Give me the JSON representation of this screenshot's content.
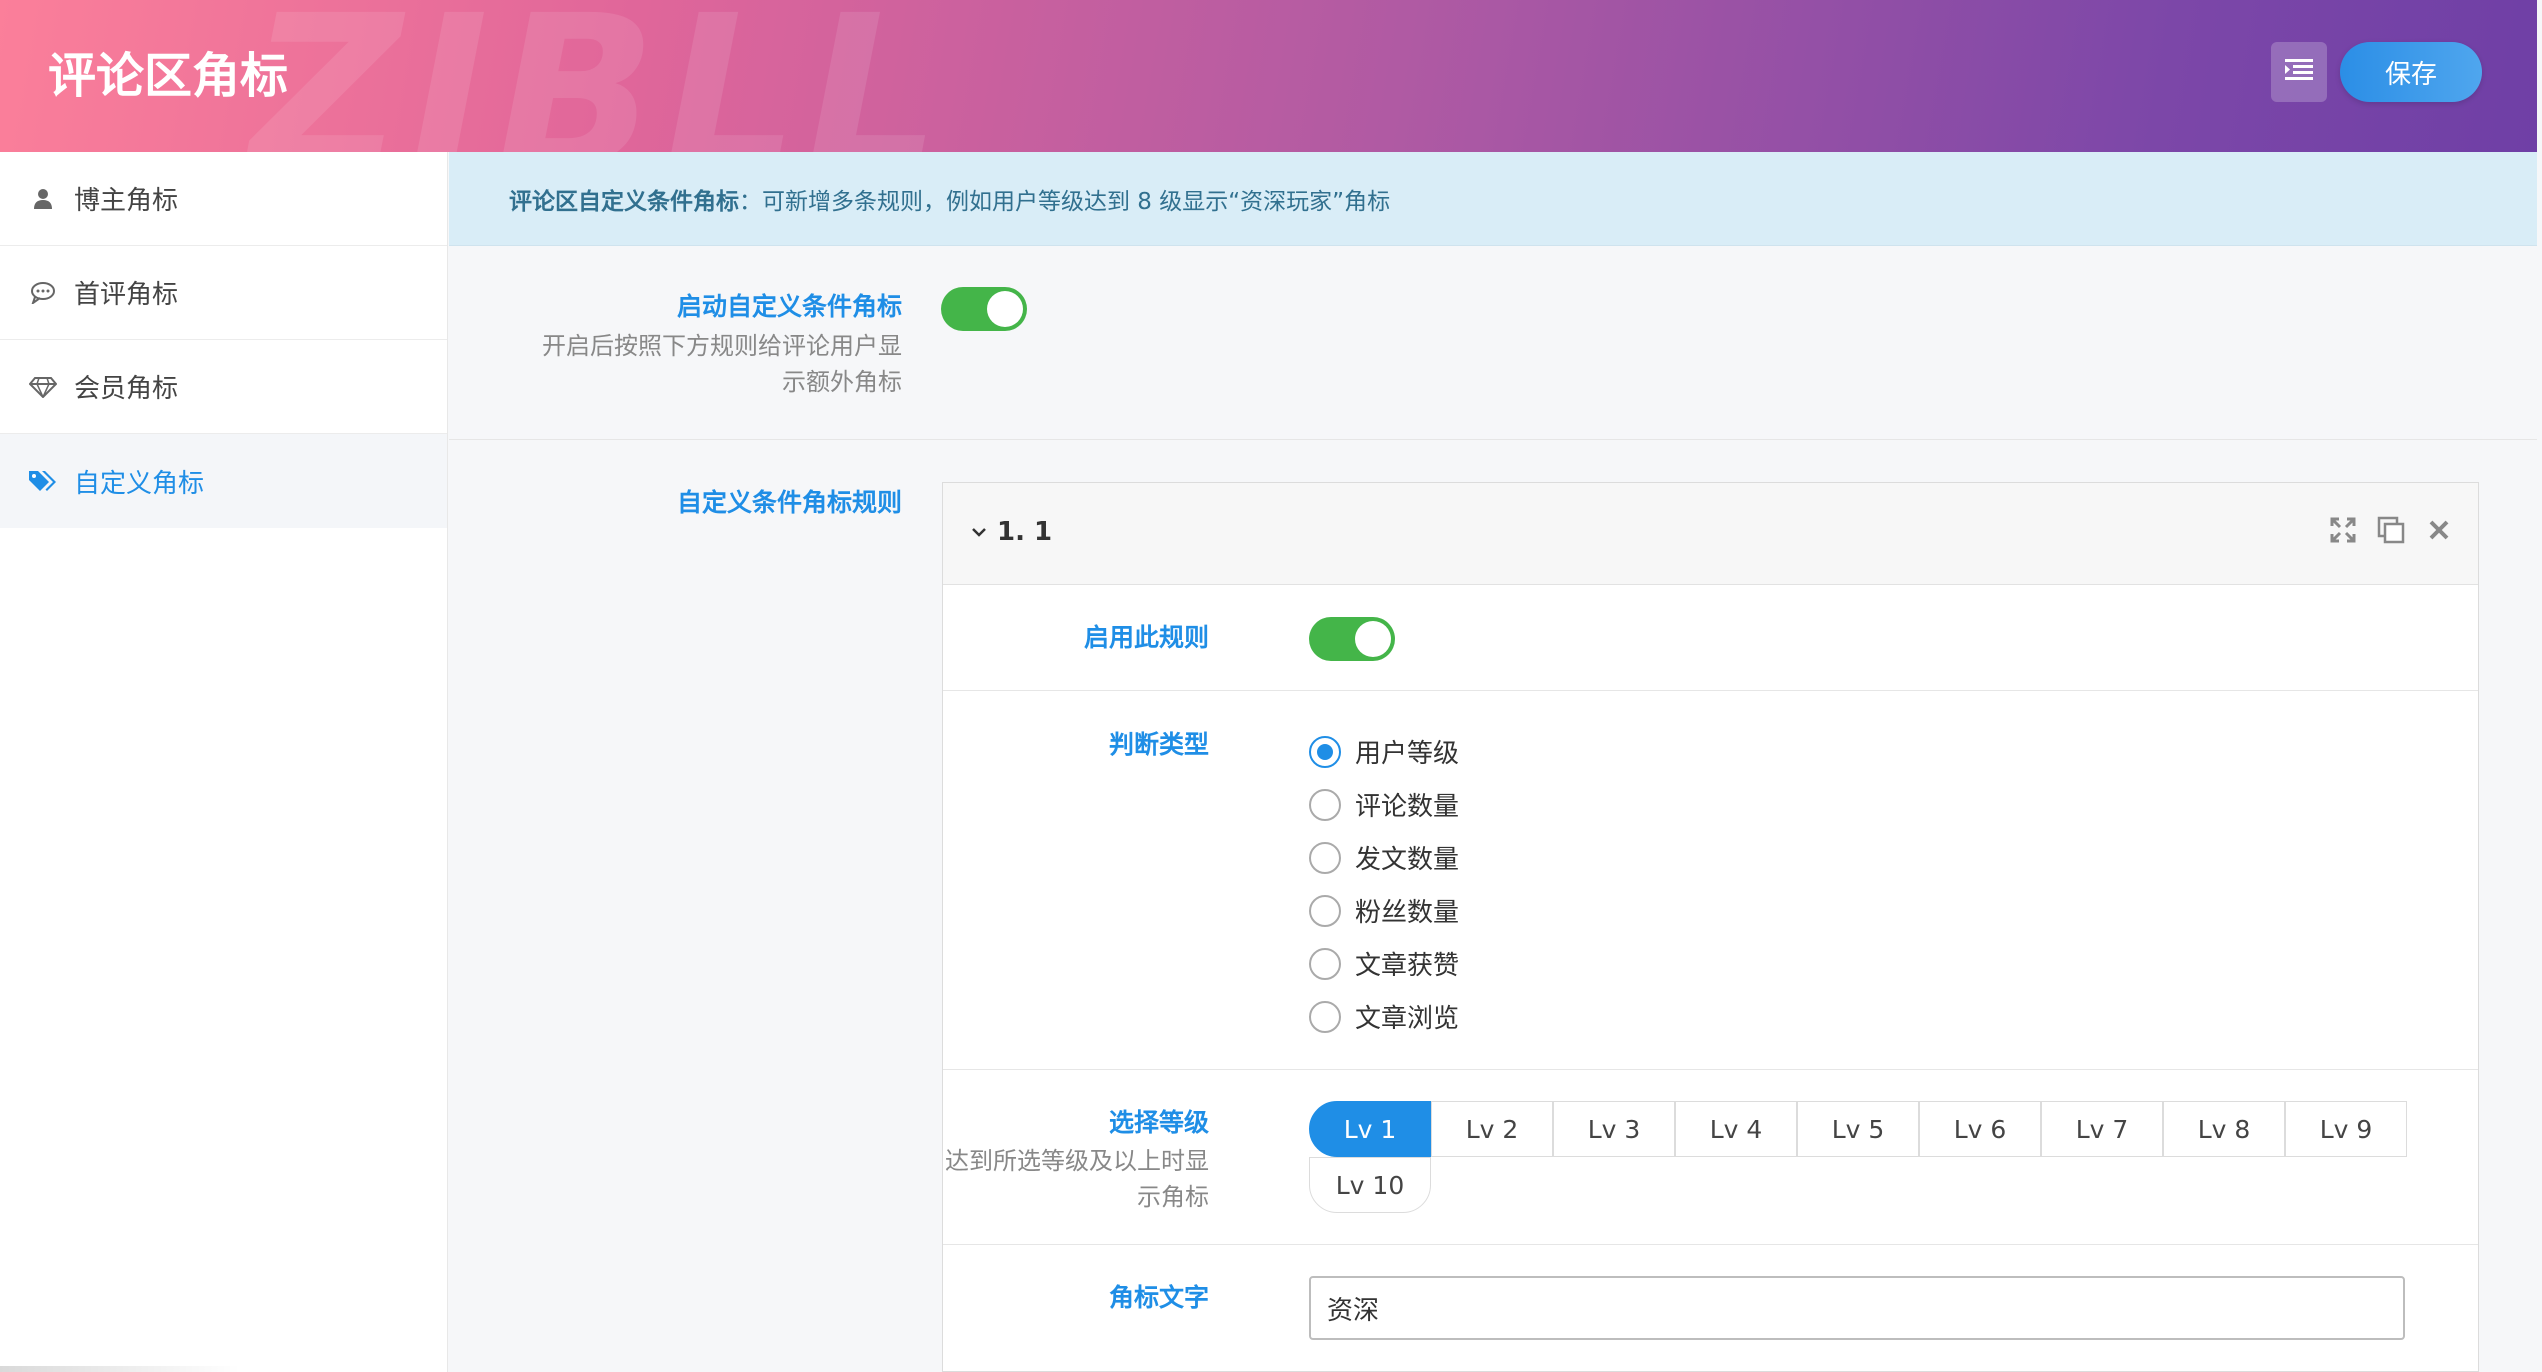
{
  "header": {
    "title": "评论区角标",
    "watermark": "ZIBLL",
    "save_label": "保存",
    "menu_icon": "list-menu-icon"
  },
  "sidebar": {
    "items": [
      {
        "label": "博主角标",
        "icon": "user-icon",
        "active": false
      },
      {
        "label": "首评角标",
        "icon": "comment-icon",
        "active": false
      },
      {
        "label": "会员角标",
        "icon": "diamond-icon",
        "active": false
      },
      {
        "label": "自定义角标",
        "icon": "tags-icon",
        "active": true
      }
    ]
  },
  "notice": {
    "bold": "评论区自定义条件角标",
    "text": "：可新增多条规则，例如用户等级达到 8 级显示“资深玩家”角标"
  },
  "enable_custom": {
    "label": "启动自定义条件角标",
    "desc_line1": "开启后按照下方规则给评论用户显",
    "desc_line2": "示额外角标",
    "enabled": true
  },
  "rules": {
    "label": "自定义条件角标规则",
    "group_title": "1. 1",
    "enable_rule": {
      "label": "启用此规则",
      "enabled": true
    },
    "judge_type": {
      "label": "判断类型",
      "options": [
        "用户等级",
        "评论数量",
        "发文数量",
        "粉丝数量",
        "文章获赞",
        "文章浏览"
      ],
      "selected": "用户等级"
    },
    "level": {
      "label": "选择等级",
      "desc_line1": "达到所选等级及以上时显",
      "desc_line2": "示角标",
      "options": [
        "Lv 1",
        "Lv 2",
        "Lv 3",
        "Lv 4",
        "Lv 5",
        "Lv 6",
        "Lv 7",
        "Lv 8",
        "Lv 9",
        "Lv 10"
      ],
      "selected": "Lv 1"
    },
    "badge_text": {
      "label": "角标文字",
      "value": "资深"
    }
  },
  "colors": {
    "accent": "#1f8ee6",
    "toggle_on": "#44b549",
    "notice_bg": "#d9edf7"
  }
}
